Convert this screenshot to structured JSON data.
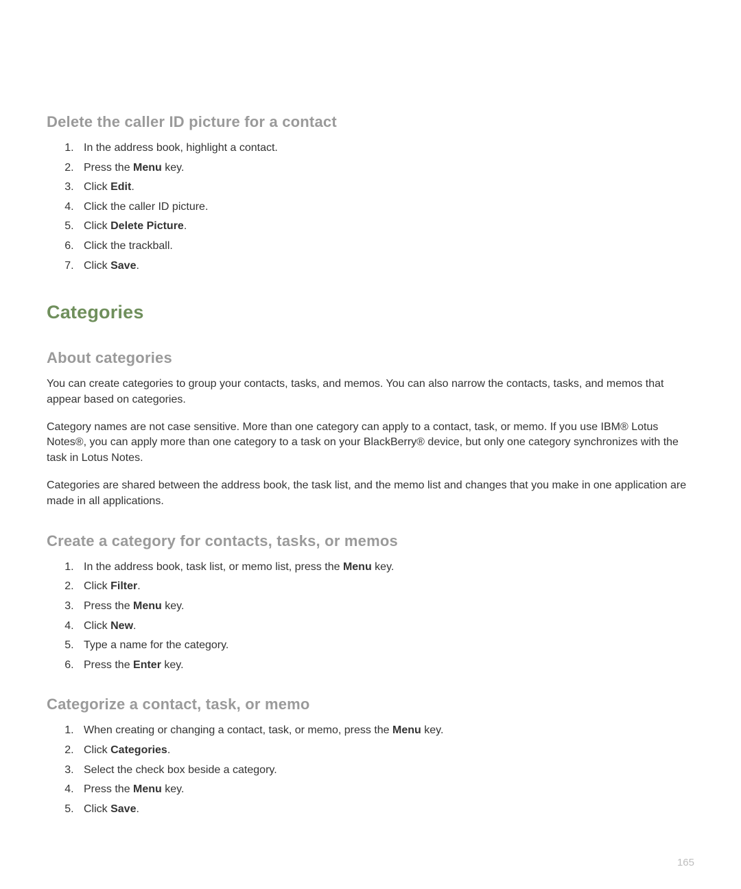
{
  "pageNumber": "165",
  "s1": {
    "heading": "Delete the caller ID picture for a contact",
    "steps": [
      {
        "pre": "In the address book, highlight a contact."
      },
      {
        "pre": "Press the ",
        "bold": "Menu",
        "post": " key."
      },
      {
        "pre": "Click ",
        "bold": "Edit",
        "post": "."
      },
      {
        "pre": "Click the caller ID picture."
      },
      {
        "pre": "Click ",
        "bold": "Delete Picture",
        "post": "."
      },
      {
        "pre": "Click the trackball."
      },
      {
        "pre": "Click ",
        "bold": "Save",
        "post": "."
      }
    ]
  },
  "mainHeading": "Categories",
  "s2": {
    "heading": "About categories",
    "paras": [
      "You can create categories to group your contacts, tasks, and memos. You can also narrow the contacts, tasks, and memos that appear based on categories.",
      "Category names are not case sensitive. More than one category can apply to a contact, task, or memo. If you use IBM® Lotus Notes®, you can apply more than one category to a task on your BlackBerry® device, but only one category synchronizes with the task in Lotus Notes.",
      "Categories are shared between the address book, the task list, and the memo list and changes that you make in one application are made in all applications."
    ]
  },
  "s3": {
    "heading": "Create a category for contacts, tasks, or memos",
    "steps": [
      {
        "pre": "In the address book, task list, or memo list, press the ",
        "bold": "Menu",
        "post": " key."
      },
      {
        "pre": "Click ",
        "bold": "Filter",
        "post": "."
      },
      {
        "pre": "Press the ",
        "bold": "Menu",
        "post": " key."
      },
      {
        "pre": "Click ",
        "bold": "New",
        "post": "."
      },
      {
        "pre": "Type a name for the category."
      },
      {
        "pre": "Press the ",
        "bold": "Enter",
        "post": " key."
      }
    ]
  },
  "s4": {
    "heading": "Categorize a contact, task, or memo",
    "steps": [
      {
        "pre": "When creating or changing a contact, task, or memo, press the ",
        "bold": "Menu",
        "post": " key."
      },
      {
        "pre": "Click ",
        "bold": "Categories",
        "post": "."
      },
      {
        "pre": "Select the check box beside a category."
      },
      {
        "pre": "Press the ",
        "bold": "Menu",
        "post": " key."
      },
      {
        "pre": "Click ",
        "bold": "Save",
        "post": "."
      }
    ]
  }
}
